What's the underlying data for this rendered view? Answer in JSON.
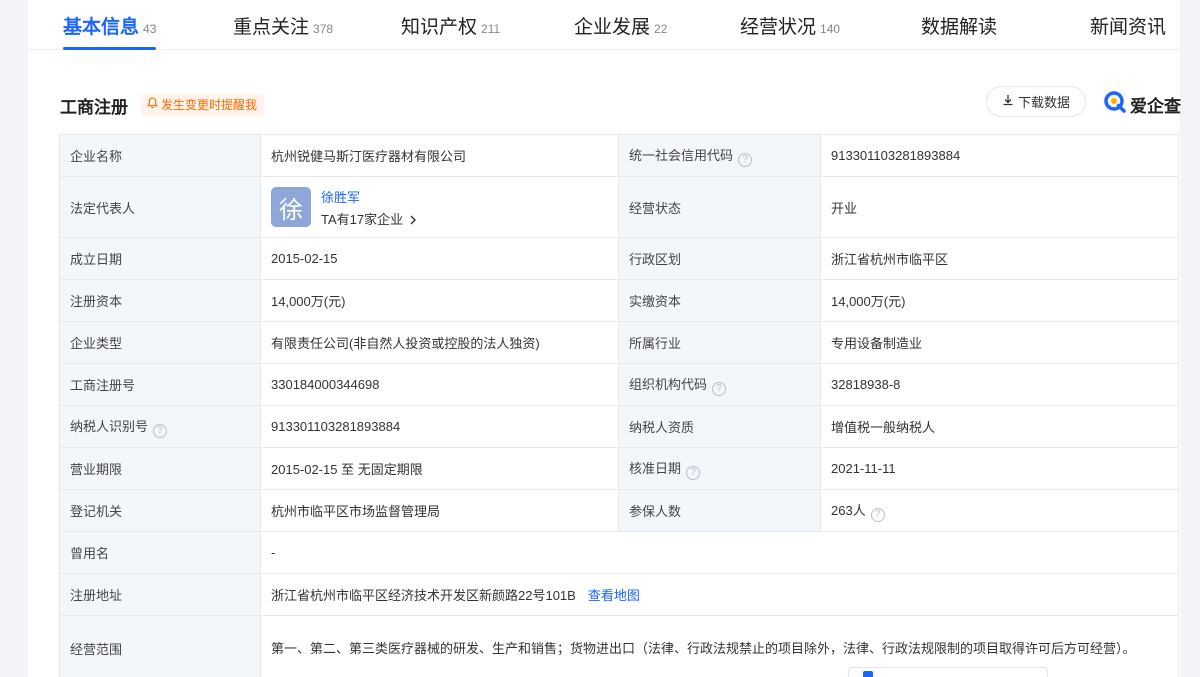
{
  "tabs": [
    {
      "label": "基本信息",
      "count": "43",
      "active": true
    },
    {
      "label": "重点关注",
      "count": "378",
      "active": false
    },
    {
      "label": "知识产权",
      "count": "211",
      "active": false
    },
    {
      "label": "企业发展",
      "count": "22",
      "active": false
    },
    {
      "label": "经营状况",
      "count": "140",
      "active": false
    },
    {
      "label": "数据解读",
      "count": "",
      "active": false
    },
    {
      "label": "新闻资讯",
      "count": "",
      "active": false
    }
  ],
  "section": {
    "title": "工商注册",
    "remind_label": "发生变更时提醒我",
    "download_label": "下载数据",
    "brand": "爱企查"
  },
  "info": {
    "company_name": {
      "label": "企业名称",
      "value": "杭州锐健马斯汀医疗器材有限公司"
    },
    "credit_code": {
      "label": "统一社会信用代码",
      "value": "913301103281893884"
    },
    "legal_rep": {
      "label": "法定代表人",
      "avatar_char": "徐",
      "name": "徐胜军",
      "companies": "TA有17家企业"
    },
    "status": {
      "label": "经营状态",
      "value": "开业"
    },
    "founded": {
      "label": "成立日期",
      "value": "2015-02-15"
    },
    "region": {
      "label": "行政区划",
      "value": "浙江省杭州市临平区"
    },
    "reg_capital": {
      "label": "注册资本",
      "value": "14,000万(元)"
    },
    "paid_capital": {
      "label": "实缴资本",
      "value": "14,000万(元)"
    },
    "company_type": {
      "label": "企业类型",
      "value": "有限责任公司(非自然人投资或控股的法人独资)"
    },
    "industry": {
      "label": "所属行业",
      "value": "专用设备制造业"
    },
    "reg_no": {
      "label": "工商注册号",
      "value": "330184000344698"
    },
    "org_code": {
      "label": "组织机构代码",
      "value": "32818938-8"
    },
    "taxpayer_id": {
      "label": "纳税人识别号",
      "value": "913301103281893884"
    },
    "taxpayer_qual": {
      "label": "纳税人资质",
      "value": "增值税一般纳税人"
    },
    "term": {
      "label": "营业期限",
      "value": "2015-02-15 至 无固定期限"
    },
    "approval_date": {
      "label": "核准日期",
      "value": "2021-11-11"
    },
    "authority": {
      "label": "登记机关",
      "value": "杭州市临平区市场监督管理局"
    },
    "insured": {
      "label": "参保人数",
      "value": "263人"
    },
    "former_name": {
      "label": "曾用名",
      "value": "-"
    },
    "address": {
      "label": "注册地址",
      "value": "浙江省杭州市临平区经济技术开发区新颜路22号101B",
      "map_link": "查看地图"
    },
    "scope": {
      "label": "经营范围",
      "value": "第一、第二、第三类医疗器械的研发、生产和销售；货物进出口（法律、行政法规禁止的项目除外，法律、行政法规限制的项目取得许可后方可经营）。"
    }
  },
  "icons": {
    "bell": "bell-icon",
    "download": "download-icon",
    "help": "question-circle-icon",
    "chevron": "chevron-right-icon",
    "brand_logo": "aiqicha-logo-icon"
  },
  "colors": {
    "accent": "#1a66ff",
    "remind": "#ff6a00",
    "key_cell_bg": "#f3f6fb"
  }
}
